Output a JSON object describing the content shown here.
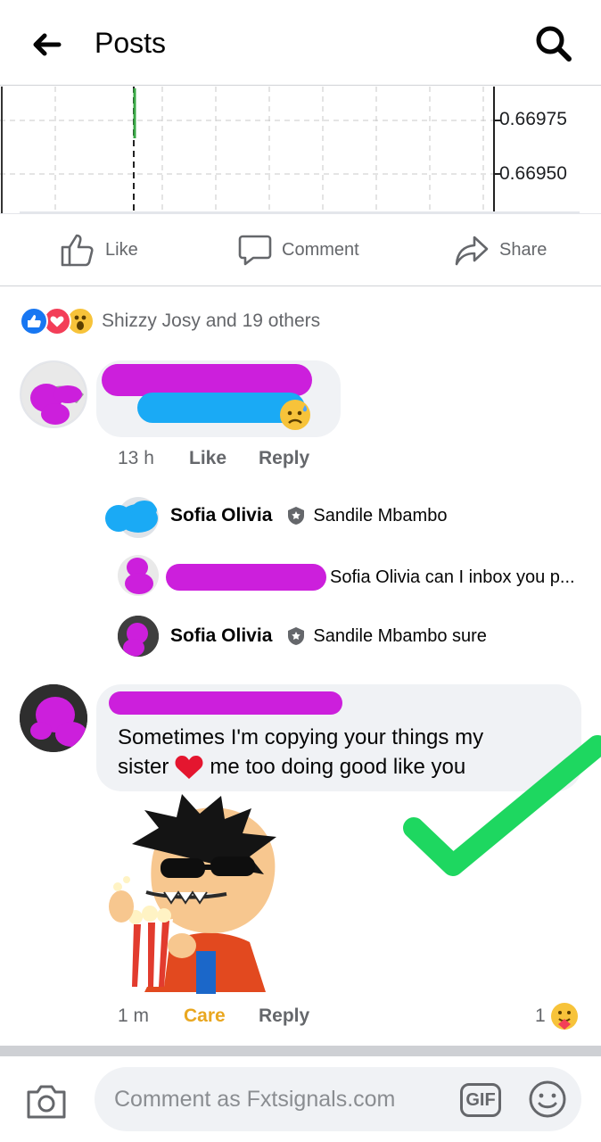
{
  "header": {
    "title": "Posts"
  },
  "chart": {
    "prices": [
      "0.66975",
      "0.66950"
    ]
  },
  "actions": {
    "like": "Like",
    "comment": "Comment",
    "share": "Share"
  },
  "reactions": {
    "summary": "Shizzy Josy and 19 others",
    "icons": [
      "like",
      "love",
      "wow"
    ]
  },
  "comment1": {
    "time": "13 h",
    "like": "Like",
    "reply": "Reply"
  },
  "replies": [
    {
      "name": "Sofia Olivia",
      "text": "Sandile Mbambo"
    },
    {
      "text": "Sofia Olivia can I inbox you p..."
    },
    {
      "name": "Sofia Olivia",
      "text": "Sandile Mbambo sure"
    }
  ],
  "comment2": {
    "text_line1": "Sometimes I'm copying your things my",
    "text_line2a": "sister",
    "text_line2b": "me too doing good like you",
    "time": "1 m",
    "reaction": "Care",
    "reply": "Reply",
    "reaction_count": "1"
  },
  "composer": {
    "placeholder": "Comment as Fxtsignals.com",
    "gif": "GIF"
  },
  "colors": {
    "brand_blue": "#1877f2",
    "care_gold": "#e9a720",
    "check_green": "#1ed760"
  }
}
